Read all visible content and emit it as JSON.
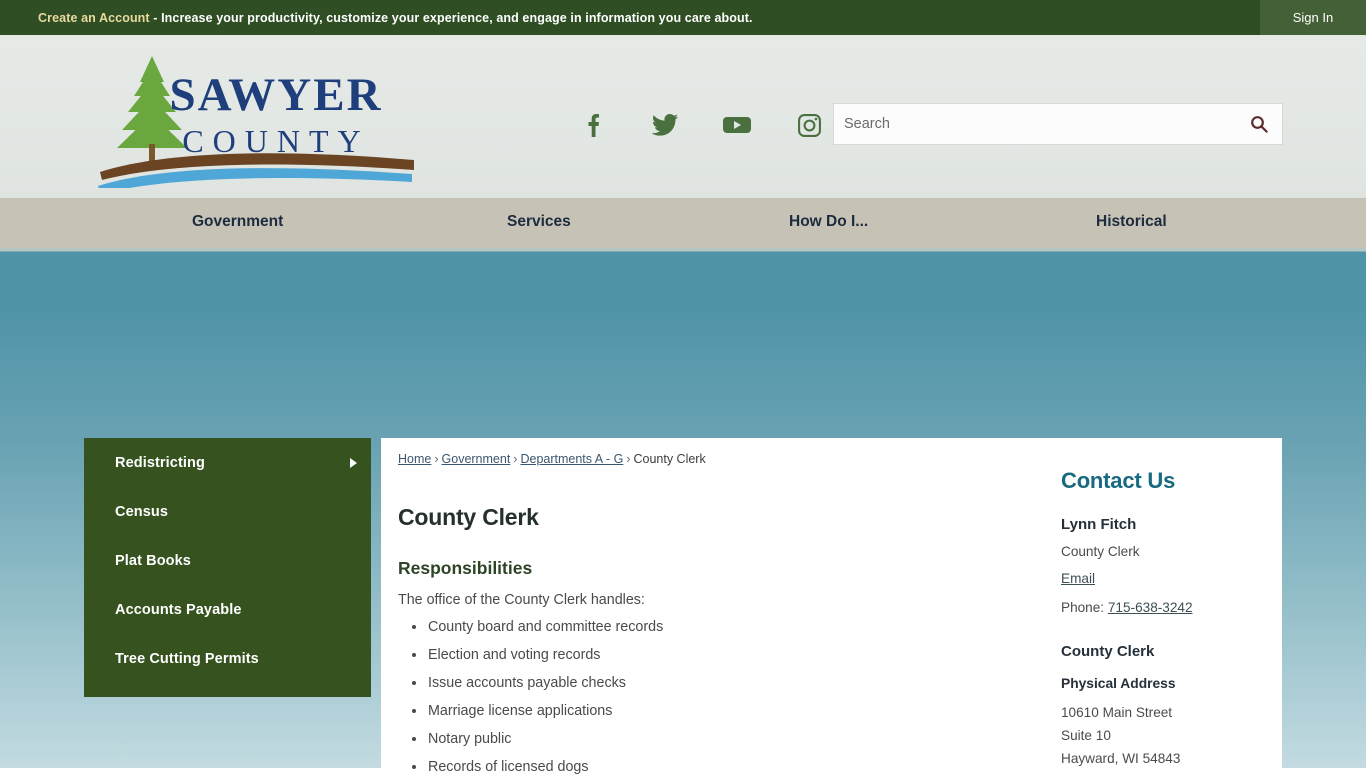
{
  "topbar": {
    "create_account": "Create an Account",
    "tagline": " - Increase your productivity, customize your experience, and engage in information you care about.",
    "signin": "Sign In",
    "bg_color": "#2f4e23",
    "accent_color": "#e8d9a0"
  },
  "header": {
    "logo_line1": "SAWYER",
    "logo_line2": "COUNTY",
    "social": [
      {
        "name": "facebook-icon",
        "label": "Facebook"
      },
      {
        "name": "twitter-icon",
        "label": "Twitter"
      },
      {
        "name": "youtube-icon",
        "label": "YouTube"
      },
      {
        "name": "instagram-icon",
        "label": "Instagram"
      }
    ],
    "search": {
      "placeholder": "Search",
      "value": "",
      "icon": "search-icon"
    }
  },
  "nav": {
    "items": [
      {
        "label": "Government"
      },
      {
        "label": "Services"
      },
      {
        "label": "How Do I..."
      },
      {
        "label": "Historical"
      }
    ],
    "bg_color": "#c6c3b6",
    "text_color": "#1d2b3f"
  },
  "sidebar": {
    "bg_color": "#35521f",
    "items": [
      {
        "label": "Redistricting",
        "has_arrow": true
      },
      {
        "label": "Census",
        "has_arrow": false
      },
      {
        "label": "Plat Books",
        "has_arrow": false
      },
      {
        "label": "Accounts Payable",
        "has_arrow": false
      },
      {
        "label": "Tree Cutting Permits",
        "has_arrow": false
      }
    ]
  },
  "breadcrumb": {
    "home": "Home",
    "government": "Government",
    "departments": "Departments A - G",
    "current": "County Clerk",
    "separator": "›"
  },
  "main": {
    "page_title": "County Clerk",
    "section_title": "Responsibilities",
    "intro": "The office of the County Clerk handles:",
    "responsibilities": [
      "County board and committee records",
      "Election and voting records",
      "Issue accounts payable checks",
      "Marriage license applications",
      "Notary public",
      "Records of licensed dogs"
    ]
  },
  "contact": {
    "heading": "Contact Us",
    "heading_color": "#186a80",
    "person_name": "Lynn Fitch",
    "person_role": "County Clerk",
    "email_label": "Email",
    "phone_label": "Phone: ",
    "phone_number": "715-638-3242",
    "department": "County Clerk",
    "address_heading": "Physical Address",
    "address_line1": "10610 Main Street",
    "address_line2": "Suite 10",
    "address_line3": "Hayward, WI 54843"
  }
}
